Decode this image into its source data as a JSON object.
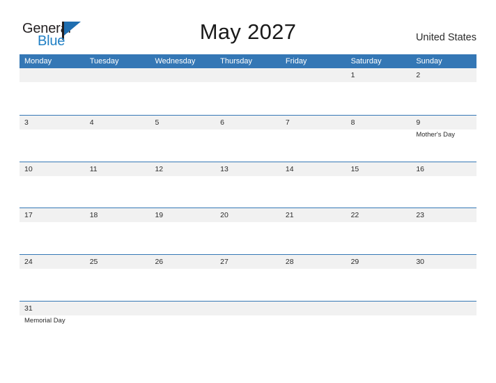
{
  "brand": {
    "name_part1": "General",
    "name_part2": "Blue",
    "colors": {
      "dark": "#231f20",
      "blue": "#1f7fc4",
      "flag_blue": "#1f6eb0"
    }
  },
  "header": {
    "title": "May 2027",
    "country": "United States"
  },
  "calendar": {
    "colors": {
      "header_bar": "#3477b5",
      "band": "#f1f1f1",
      "row_rule": "#3477b5",
      "text": "#2b2b2b"
    },
    "weekdays": [
      "Monday",
      "Tuesday",
      "Wednesday",
      "Thursday",
      "Friday",
      "Saturday",
      "Sunday"
    ],
    "weeks": [
      [
        {
          "date": "",
          "event": ""
        },
        {
          "date": "",
          "event": ""
        },
        {
          "date": "",
          "event": ""
        },
        {
          "date": "",
          "event": ""
        },
        {
          "date": "",
          "event": ""
        },
        {
          "date": "1",
          "event": ""
        },
        {
          "date": "2",
          "event": ""
        }
      ],
      [
        {
          "date": "3",
          "event": ""
        },
        {
          "date": "4",
          "event": ""
        },
        {
          "date": "5",
          "event": ""
        },
        {
          "date": "6",
          "event": ""
        },
        {
          "date": "7",
          "event": ""
        },
        {
          "date": "8",
          "event": ""
        },
        {
          "date": "9",
          "event": "Mother's Day"
        }
      ],
      [
        {
          "date": "10",
          "event": ""
        },
        {
          "date": "11",
          "event": ""
        },
        {
          "date": "12",
          "event": ""
        },
        {
          "date": "13",
          "event": ""
        },
        {
          "date": "14",
          "event": ""
        },
        {
          "date": "15",
          "event": ""
        },
        {
          "date": "16",
          "event": ""
        }
      ],
      [
        {
          "date": "17",
          "event": ""
        },
        {
          "date": "18",
          "event": ""
        },
        {
          "date": "19",
          "event": ""
        },
        {
          "date": "20",
          "event": ""
        },
        {
          "date": "21",
          "event": ""
        },
        {
          "date": "22",
          "event": ""
        },
        {
          "date": "23",
          "event": ""
        }
      ],
      [
        {
          "date": "24",
          "event": ""
        },
        {
          "date": "25",
          "event": ""
        },
        {
          "date": "26",
          "event": ""
        },
        {
          "date": "27",
          "event": ""
        },
        {
          "date": "28",
          "event": ""
        },
        {
          "date": "29",
          "event": ""
        },
        {
          "date": "30",
          "event": ""
        }
      ],
      [
        {
          "date": "31",
          "event": "Memorial Day"
        },
        {
          "date": "",
          "event": ""
        },
        {
          "date": "",
          "event": ""
        },
        {
          "date": "",
          "event": ""
        },
        {
          "date": "",
          "event": ""
        },
        {
          "date": "",
          "event": ""
        },
        {
          "date": "",
          "event": ""
        }
      ]
    ]
  }
}
